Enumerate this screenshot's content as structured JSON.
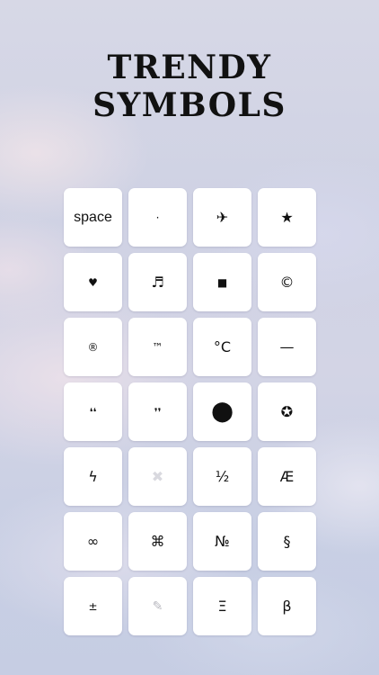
{
  "title": {
    "line1": "TRENDY",
    "line2": "SYMBOLS"
  },
  "keys": [
    {
      "label": "space",
      "name": "key-space"
    },
    {
      "label": "·",
      "name": "key-middle-dot"
    },
    {
      "label": "✈",
      "name": "key-airplane"
    },
    {
      "label": "★",
      "name": "key-star"
    },
    {
      "label": "♥",
      "name": "key-heart"
    },
    {
      "label": "♬",
      "name": "key-music-notes"
    },
    {
      "label": "■",
      "name": "key-black-square"
    },
    {
      "label": "©",
      "name": "key-copyright"
    },
    {
      "label": "®",
      "name": "key-registered"
    },
    {
      "label": "™",
      "name": "key-trademark"
    },
    {
      "label": "°C",
      "name": "key-degrees-celsius"
    },
    {
      "label": "—",
      "name": "key-em-dash"
    },
    {
      "label": "❛❛",
      "name": "key-open-quote"
    },
    {
      "label": "❜❜",
      "name": "key-close-quote"
    },
    {
      "label": "⬤",
      "name": "key-black-circle"
    },
    {
      "label": "✪",
      "name": "key-circled-star"
    },
    {
      "label": "ϟ",
      "name": "key-lightning"
    },
    {
      "label": "✖",
      "name": "key-multiplication-x"
    },
    {
      "label": "½",
      "name": "key-one-half"
    },
    {
      "label": "Æ",
      "name": "key-ae"
    },
    {
      "label": "∞",
      "name": "key-infinity"
    },
    {
      "label": "⌘",
      "name": "key-command"
    },
    {
      "label": "№",
      "name": "key-numero"
    },
    {
      "label": "§",
      "name": "key-section"
    },
    {
      "label": "±",
      "name": "key-plus-minus"
    },
    {
      "label": "✎",
      "name": "key-pencil"
    },
    {
      "label": "Ξ",
      "name": "key-xi"
    },
    {
      "label": "β",
      "name": "key-beta"
    }
  ]
}
